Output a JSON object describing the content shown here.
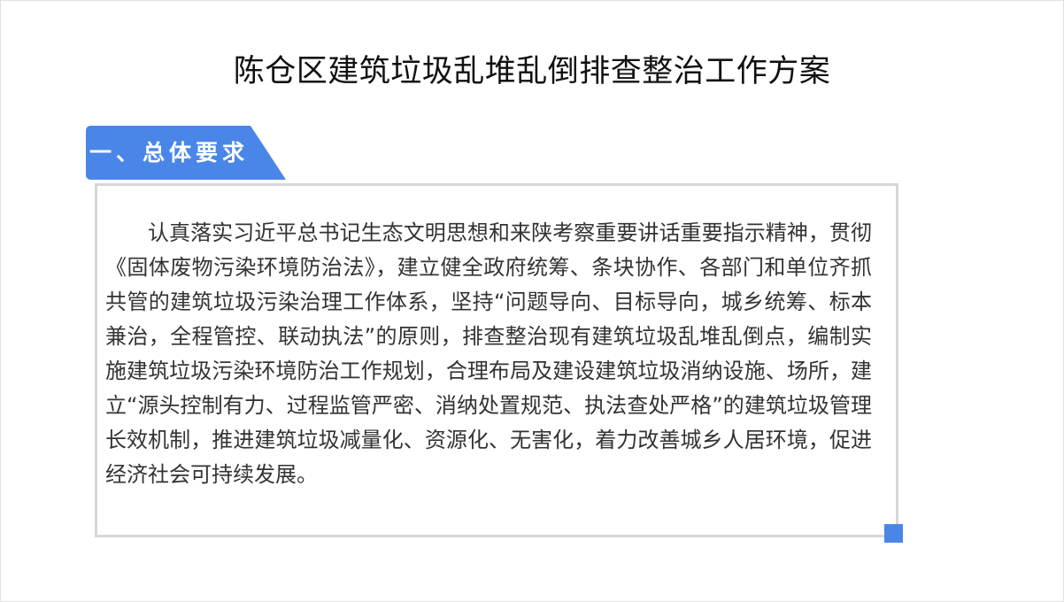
{
  "document": {
    "title": "陈仓区建筑垃圾乱堆乱倒排查整治工作方案",
    "section": {
      "heading": "一、总体要求",
      "body": "认真落实习近平总书记生态文明思想和来陕考察重要讲话重要指示精神，贯彻《固体废物污染环境防治法》，建立健全政府统筹、条块协作、各部门和单位齐抓共管的建筑垃圾污染治理工作体系，坚持“问题导向、目标导向，城乡统筹、标本兼治，全程管控、联动执法”的原则，排查整治现有建筑垃圾乱堆乱倒点，编制实施建筑垃圾污染环境防治工作规划，合理布局及建设建筑垃圾消纳设施、场所，建立“源头控制有力、过程监管严密、消纳处置规范、执法查处严格”的建筑垃圾管理长效机制，推进建筑垃圾减量化、资源化、无害化，着力改善城乡人居环境，促进经济社会可持续发展。"
    }
  },
  "colors": {
    "accent": "#4a86e8",
    "border": "#d7d7d7",
    "title": "#111111",
    "body": "#333333"
  }
}
